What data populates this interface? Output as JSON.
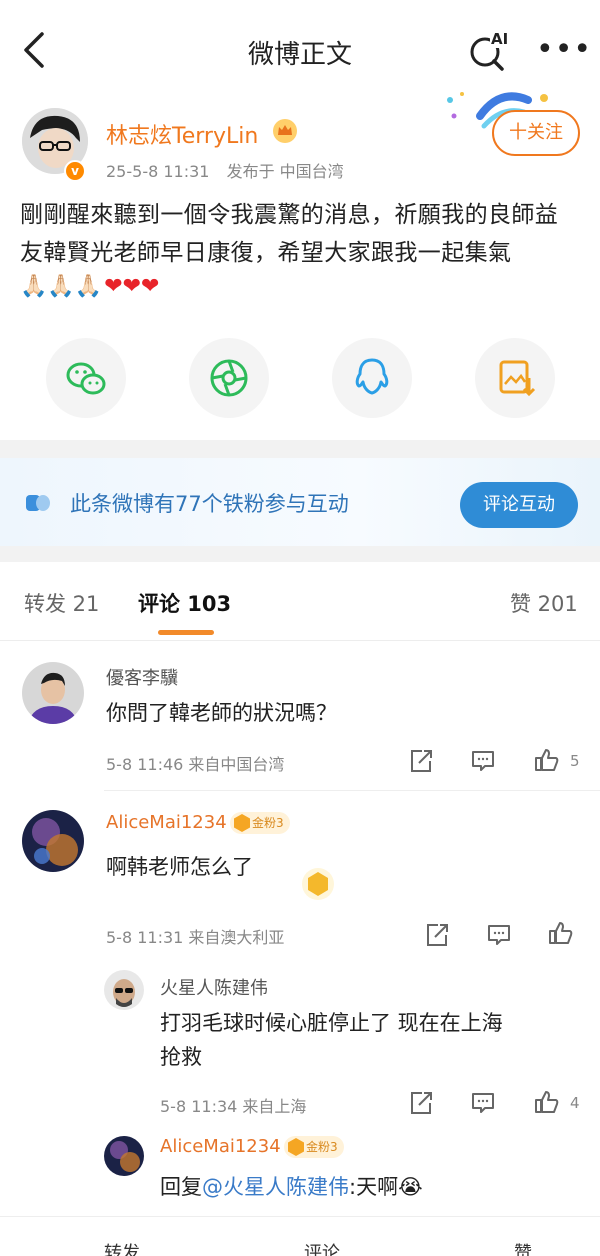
{
  "header": {
    "title": "微博正文",
    "ai_label": "AI",
    "back_icon": "chevron-left-icon",
    "more_label": "•••"
  },
  "post": {
    "author": "林志炫TerryLin",
    "verified_badge": "v",
    "date": "25-5-8 11:31",
    "location": "发布于 中国台湾",
    "follow_label": "十关注",
    "text": "剛剛醒來聽到一個令我震驚的消息，祈願我的良師益友韓賢光老師早日康復，希望大家跟我一起集氣",
    "emojis_hands": "🙏🏻🙏🏻🙏🏻",
    "emojis_hearts": "❤❤❤"
  },
  "share": {
    "items": [
      "wechat-icon",
      "moments-icon",
      "qq-icon",
      "save-image-icon"
    ]
  },
  "fan_banner": {
    "text": "此条微博有77个铁粉参与互动",
    "button": "评论互动"
  },
  "tabs": {
    "repost": "转发 21",
    "comments": "评论 103",
    "likes": "赞 201"
  },
  "comments": [
    {
      "name": "優客李驥",
      "text": "你問了韓老師的狀況嗎？",
      "meta": "5-8 11:46  来自中国台湾",
      "likes": "5"
    },
    {
      "name": "AliceMai1234",
      "badge": "金粉3",
      "text": "啊韩老师怎么了",
      "meta": "5-8 11:31  来自澳大利亚",
      "likes": ""
    },
    {
      "name": "火星人陈建伟",
      "text_line1": "打羽毛球时候心脏停止了 现在在上海",
      "text_line2": "抢救",
      "meta": "5-8 11:34  来自上海",
      "likes": "4"
    },
    {
      "name": "AliceMai1234",
      "badge": "金粉3",
      "reply_prefix": "回复",
      "mention": "@火星人陈建伟",
      "reply_text": ":天啊😭"
    }
  ],
  "bottom_bar": {
    "repost": "转发",
    "comment": "评论",
    "like": "赞"
  },
  "colors": {
    "accent_orange": "#f0781e",
    "link_blue": "#3a7bc8",
    "fan_blue": "#2f8cd6"
  }
}
